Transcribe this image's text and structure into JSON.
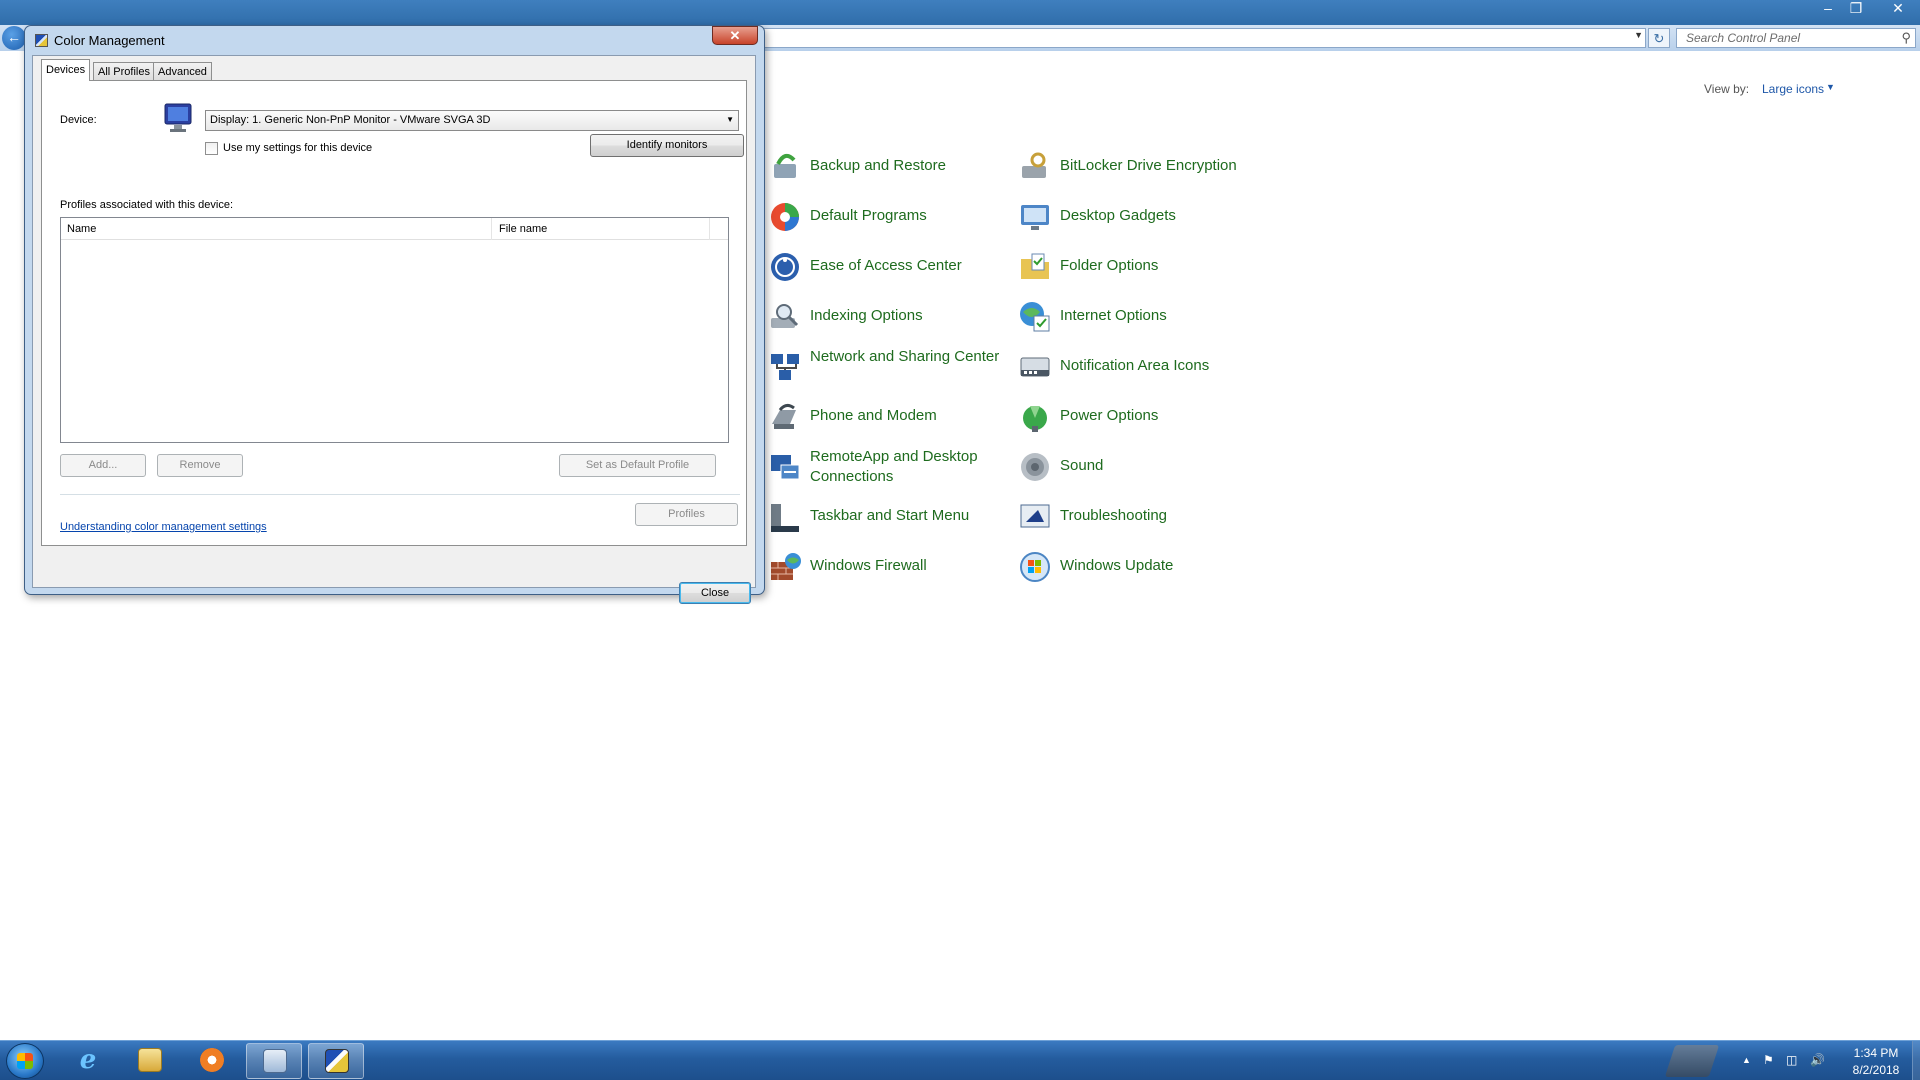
{
  "control_panel": {
    "search_placeholder": "Search Control Panel",
    "view_by_label": "View by:",
    "view_by_value": "Large icons",
    "items": [
      {
        "label": "Backup and Restore",
        "icon": "backup-restore-icon"
      },
      {
        "label": "BitLocker Drive Encryption",
        "icon": "bitlocker-icon"
      },
      {
        "label": "Default Programs",
        "icon": "default-programs-icon"
      },
      {
        "label": "Desktop Gadgets",
        "icon": "desktop-gadgets-icon"
      },
      {
        "label": "Ease of Access Center",
        "icon": "ease-of-access-icon"
      },
      {
        "label": "Folder Options",
        "icon": "folder-options-icon"
      },
      {
        "label": "Indexing Options",
        "icon": "indexing-options-icon"
      },
      {
        "label": "Internet Options",
        "icon": "internet-options-icon"
      },
      {
        "label": "Network and Sharing Center",
        "icon": "network-sharing-icon"
      },
      {
        "label": "Notification Area Icons",
        "icon": "notification-area-icon"
      },
      {
        "label": "Phone and Modem",
        "icon": "phone-modem-icon"
      },
      {
        "label": "Power Options",
        "icon": "power-options-icon"
      },
      {
        "label": "RemoteApp and Desktop Connections",
        "icon": "remoteapp-icon"
      },
      {
        "label": "Sound",
        "icon": "sound-icon"
      },
      {
        "label": "Taskbar and Start Menu",
        "icon": "taskbar-start-icon"
      },
      {
        "label": "Troubleshooting",
        "icon": "troubleshooting-icon"
      },
      {
        "label": "Windows Firewall",
        "icon": "windows-firewall-icon"
      },
      {
        "label": "Windows Update",
        "icon": "windows-update-icon"
      }
    ]
  },
  "dialog": {
    "title": "Color Management",
    "tabs": [
      "Devices",
      "All Profiles",
      "Advanced"
    ],
    "device_label": "Device:",
    "device_value": "Display: 1. Generic Non-PnP Monitor - VMware SVGA 3D",
    "use_settings_label": "Use my settings for this device",
    "use_settings_checked": false,
    "identify_button": "Identify monitors",
    "profiles_assoc_label": "Profiles associated with this device:",
    "columns": [
      "Name",
      "File name"
    ],
    "add_button": "Add...",
    "remove_button": "Remove",
    "default_button": "Set as Default Profile",
    "help_link": "Understanding color management settings",
    "profiles_button": "Profiles",
    "close_button": "Close"
  },
  "taskbar": {
    "time": "1:34 PM",
    "date": "8/2/2018"
  },
  "colors": {
    "link_green": "#1e6b1e",
    "link_blue": "#0645ad",
    "taskbar": "#245c9e"
  }
}
